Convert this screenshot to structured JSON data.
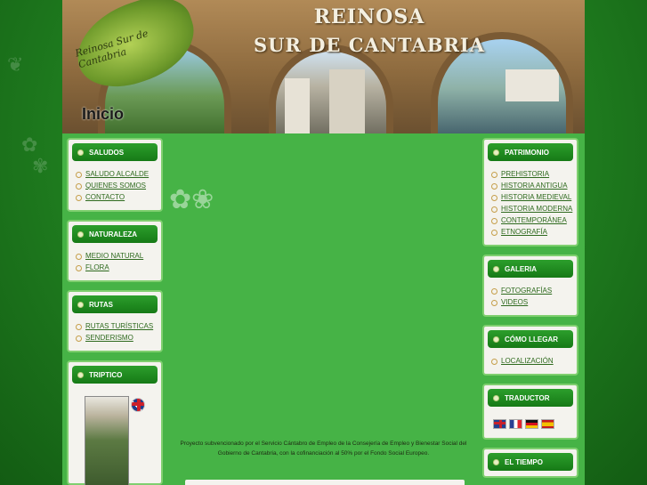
{
  "header": {
    "logo_text": "Reinosa Sur de Cantabria",
    "title_line1": "REINOSA",
    "title_line2": "SUR DE CANTABRIA",
    "page_heading": "Inicio"
  },
  "left_sidebar": [
    {
      "title": "SALUDOS",
      "items": [
        "SALUDO ALCALDE",
        "QUIENES SOMOS",
        "CONTACTO"
      ]
    },
    {
      "title": "NATURALEZA",
      "items": [
        "MEDIO NATURAL",
        "FLORA"
      ]
    },
    {
      "title": "RUTAS",
      "items": [
        "RUTAS TURÍSTICAS",
        "SENDERISMO"
      ]
    },
    {
      "title": "TRIPTICO"
    }
  ],
  "right_sidebar": [
    {
      "title": "PATRIMONIO",
      "items": [
        "PREHISTORIA",
        "HISTORIA ANTIGUA",
        "HISTORIA MEDIEVAL",
        "HISTORIA MODERNA",
        "CONTEMPORÁNEA",
        "ETNOGRAFÍA"
      ]
    },
    {
      "title": "GALERIA",
      "items": [
        "FOTOGRAFÍAS",
        "VIDEOS"
      ]
    },
    {
      "title": "CÓMO LLEGAR",
      "items": [
        "LOCALIZACIÓN"
      ]
    },
    {
      "title": "TRADUCTOR"
    },
    {
      "title": "EL TIEMPO"
    }
  ],
  "translator_flags": [
    "flag-english",
    "flag-french",
    "flag-german",
    "flag-spanish"
  ],
  "main": {
    "project_note": "Proyecto subvencionado por el Servicio Cántabro de Empleo de la Consejería de Empleo y Bienestar Social del Gobierno de Cantabria, con la cofinanciación al 50% por el Fondo Social Europeo."
  },
  "colors": {
    "accent": "#167a16",
    "background": "#2f9a2f",
    "box": "#f4f3ee",
    "link": "#2e6a1e"
  }
}
